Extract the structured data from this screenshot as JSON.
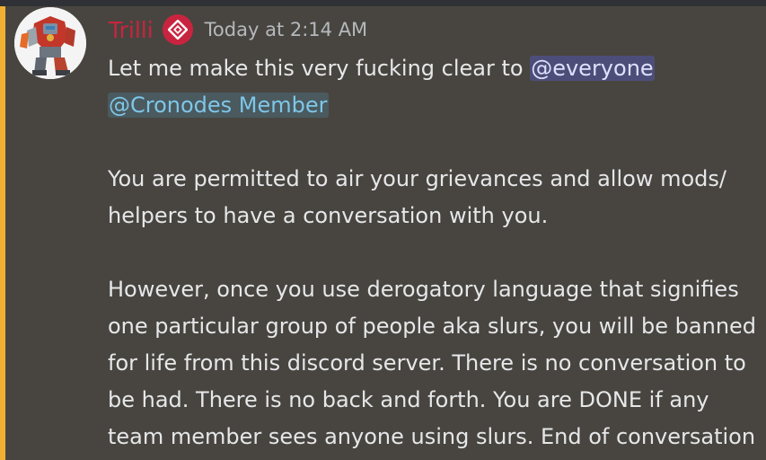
{
  "colors": {
    "background": "#484540",
    "accent_bar": "#f0b132",
    "username": "#c9243f",
    "role_badge": "#c9243f",
    "timestamp": "#b5b8bc",
    "text": "#e6e7e9",
    "everyone_mention": "#dee0fc",
    "role_mention": "#7fc6e8"
  },
  "message": {
    "author": "Trilli",
    "badge_icon": "role-badge-icon",
    "avatar_icon": "robot-avatar",
    "timestamp": "Today at 2:14 AM",
    "line1_prefix": "Let me make this very fucking clear to ",
    "mention_everyone": "@everyone",
    "mention_role": "@Cronodes Member",
    "paragraph2": "You are permitted to air your grievances and allow mods/\nhelpers to have a conversation with you.",
    "paragraph3": "However, once you use derogatory language that signifies\none particular group of people aka slurs, you will be banned\nfor life from this discord server. There is no conversation to\nbe had. There is no back and forth. You are DONE if any\nteam member sees anyone using slurs. End of conversation"
  }
}
